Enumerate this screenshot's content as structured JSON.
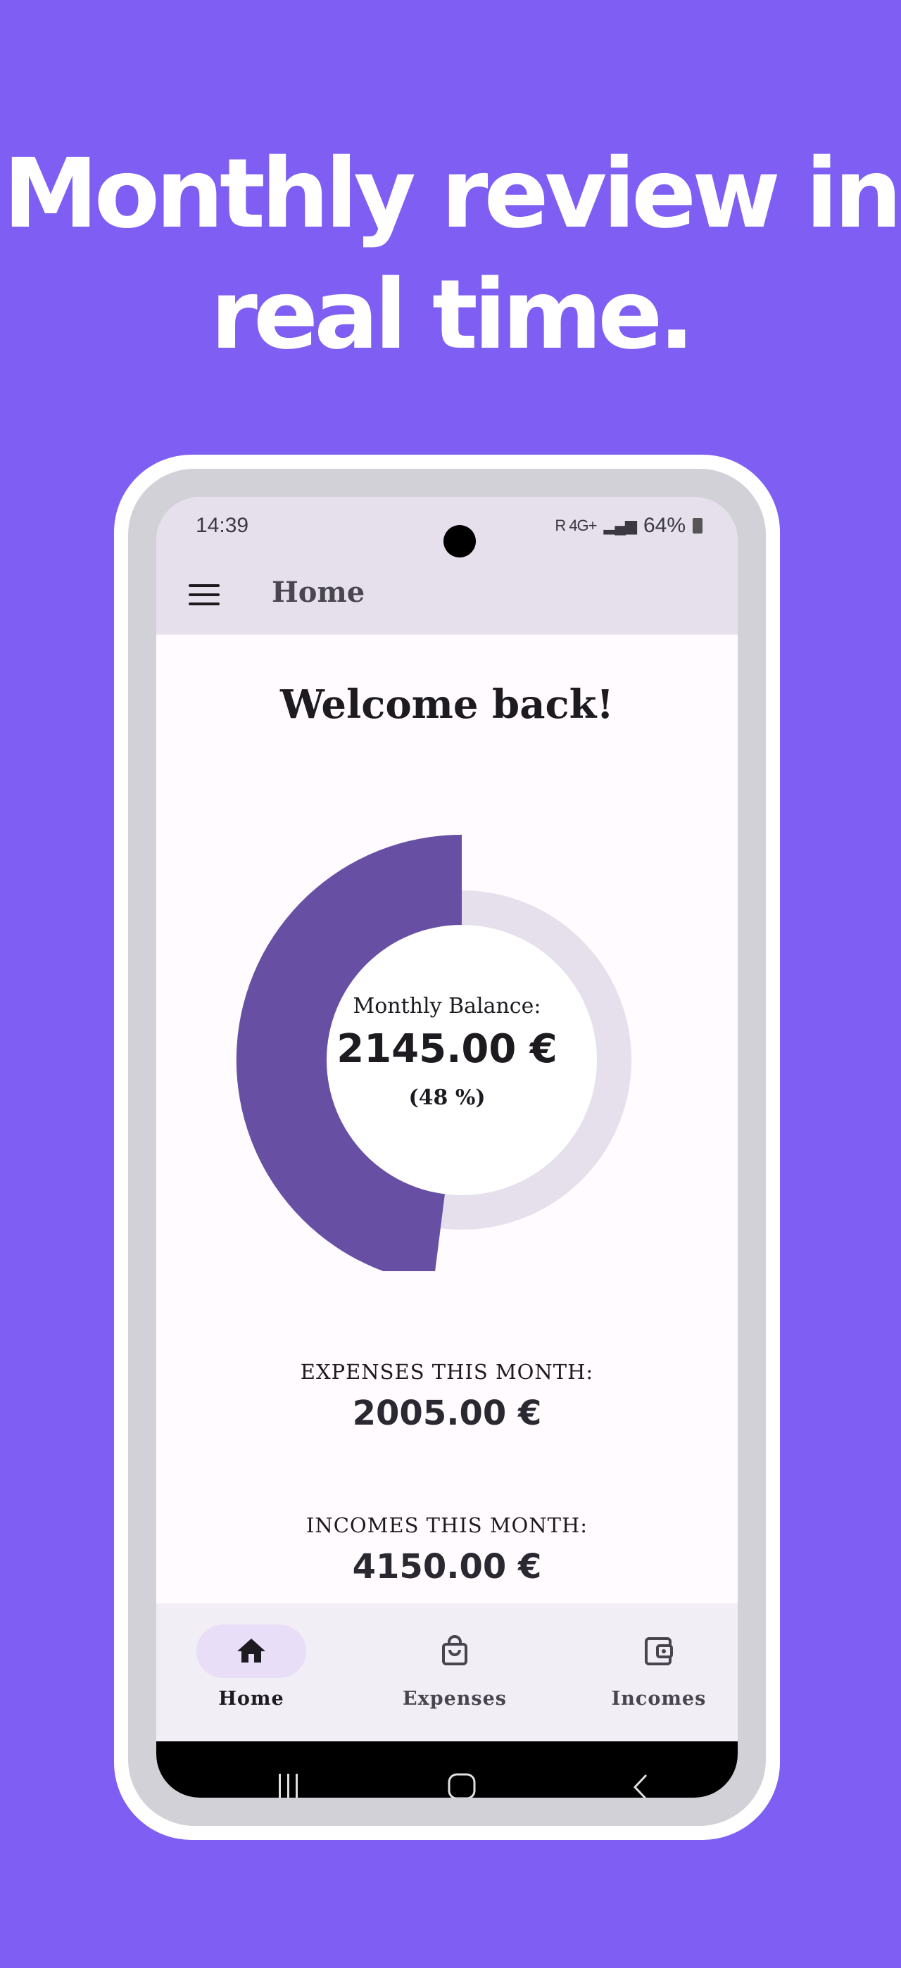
{
  "promo": {
    "headline_line1": "Monthly review in",
    "headline_line2": "real time."
  },
  "status_bar": {
    "time": "14:39",
    "signal_text": "R 4G+",
    "battery": "64%"
  },
  "app_bar": {
    "menu_icon": "hamburger-menu-icon",
    "title": "Home"
  },
  "home": {
    "welcome": "Welcome back!",
    "balance_label": "Monthly Balance:",
    "balance_value": "2145.00 €",
    "balance_percent": "(48 %)",
    "expenses_label": "EXPENSES THIS MONTH:",
    "expenses_value": "2005.00 €",
    "incomes_label": "INCOMES THIS MONTH:",
    "incomes_value": "4150.00 €"
  },
  "chart_data": {
    "type": "pie",
    "style": "donut",
    "highlighted_fraction": 0.48,
    "colors": {
      "highlight": "#6750a4",
      "remainder": "#e6e0ec"
    }
  },
  "bottom_nav": {
    "items": [
      {
        "label": "Home",
        "icon": "home-icon",
        "active": true
      },
      {
        "label": "Expenses",
        "icon": "shopping-bag-icon",
        "active": false
      },
      {
        "label": "Incomes",
        "icon": "wallet-icon",
        "active": false
      }
    ]
  },
  "system_nav": {
    "recents_icon": "recents-icon",
    "home_icon": "home-circle-icon",
    "back_icon": "back-icon"
  },
  "colors": {
    "background": "#7f5ef4",
    "accent": "#6750a4",
    "active_pill": "#e8def8"
  }
}
